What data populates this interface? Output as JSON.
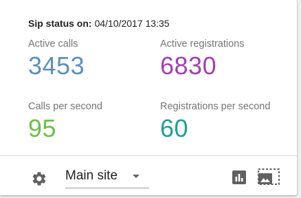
{
  "status": {
    "label": "Sip status on:",
    "value": "04/10/2017 13:35"
  },
  "metrics": [
    {
      "label": "Active calls",
      "value": "3453",
      "color": "#5b8fc0"
    },
    {
      "label": "Active registrations",
      "value": "6830",
      "color": "#a23fb3"
    },
    {
      "label": "Calls per second",
      "value": "95",
      "color": "#6cbf45"
    },
    {
      "label": "Registrations per second",
      "value": "60",
      "color": "#1f9f94"
    }
  ],
  "footer": {
    "settings_icon": "gear-icon",
    "site_select": {
      "selected": "Main site"
    },
    "chart_icon": "bar-chart-icon",
    "image_icon": "image-selection-icon"
  },
  "colors": {
    "icon": "#616161",
    "text": "#212121",
    "label": "#757575"
  }
}
